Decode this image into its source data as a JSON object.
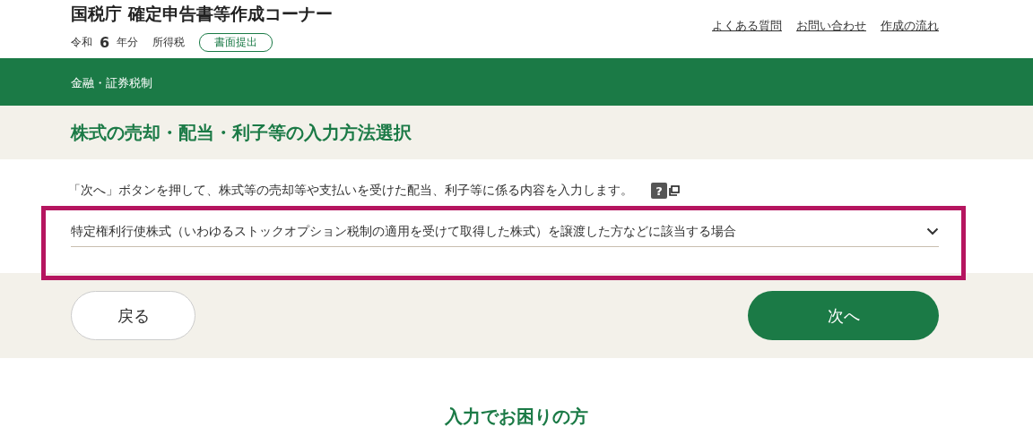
{
  "header": {
    "title": "国税庁 確定申告書等作成コーナー",
    "era": "令和",
    "year": "6",
    "year_unit": "年分",
    "tax": "所得税",
    "badge": "書面提出",
    "links": [
      "よくある質問",
      "お問い合わせ",
      "作成の流れ"
    ]
  },
  "breadcrumb": "金融・証券税制",
  "page_title": "株式の売却・配当・利子等の入力方法選択",
  "instruction": "「次へ」ボタンを押して、株式等の売却等や支払いを受けた配当、利子等に係る内容を入力します。",
  "help_icon": "?",
  "select": {
    "value": "特定権利行使株式（いわゆるストックオプション税制の適用を受けて取得した株式）を譲渡した方などに該当する場合",
    "highlighted": true
  },
  "buttons": {
    "back": "戻る",
    "next": "次へ"
  },
  "help_heading": "入力でお困りの方"
}
